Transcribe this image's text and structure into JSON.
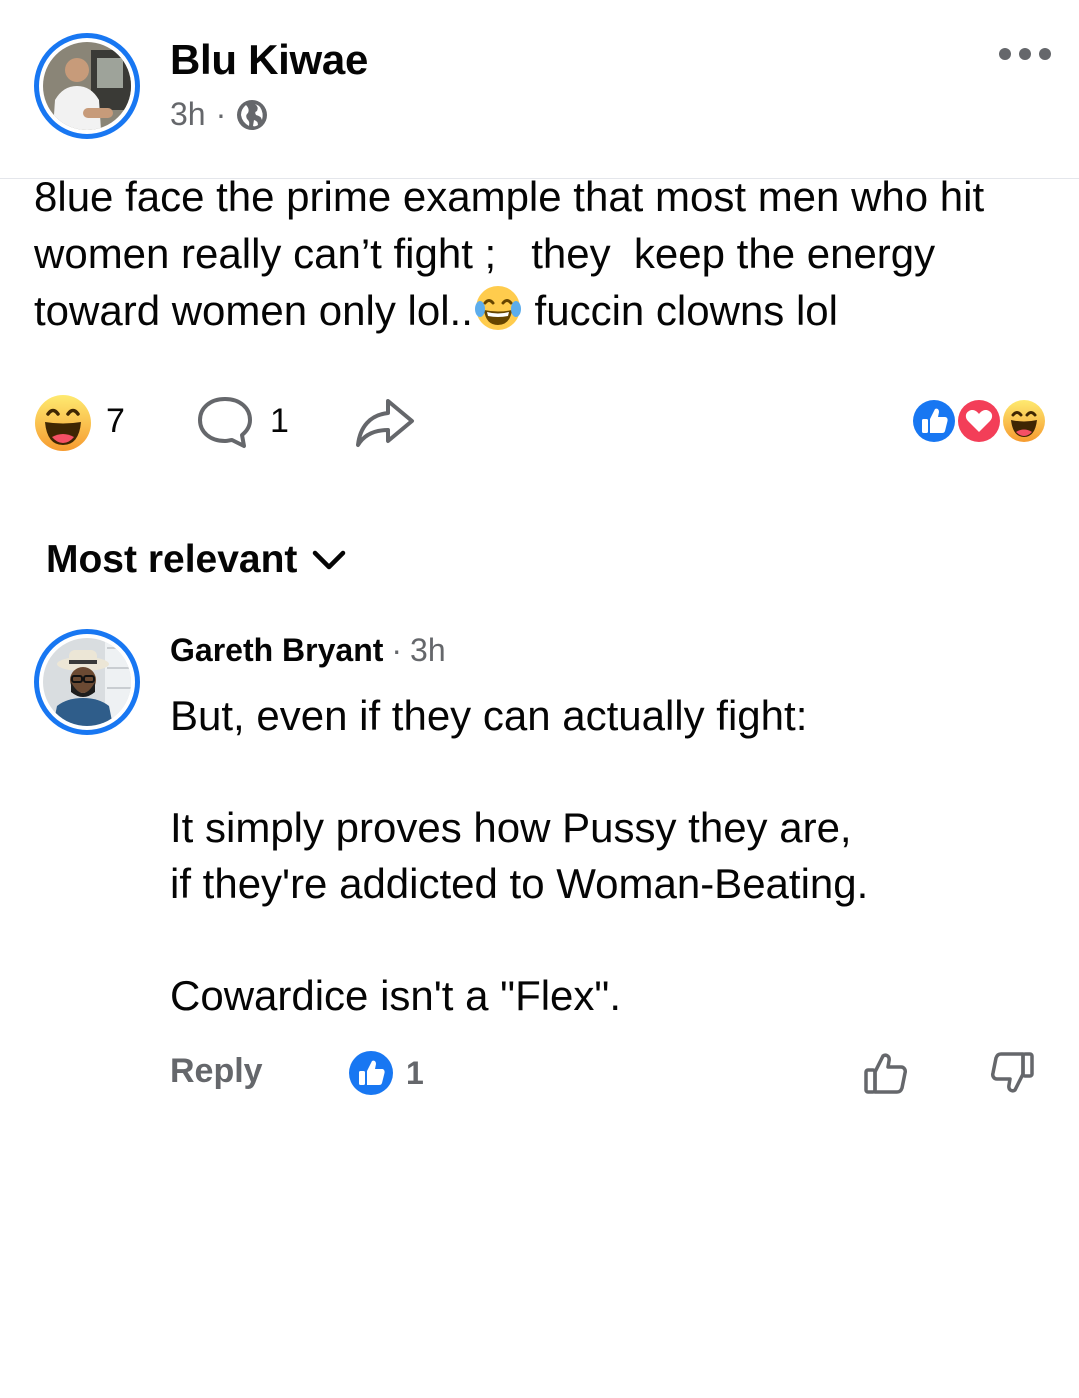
{
  "post": {
    "author": "Blu Kiwae",
    "time": "3h",
    "separator": "·",
    "privacy_icon": "globe-icon",
    "text_before_emoji": "8lue face the prime example that most men who hit women really can’t fight ;   they  keep the energy toward women only lol..",
    "inline_emoji": "tears-of-joy-emoji",
    "text_after_emoji": " fuccin clowns lol",
    "reaction_count": "7",
    "comment_count": "1",
    "reactions_summary": [
      "like-reaction-icon",
      "love-reaction-icon",
      "haha-reaction-icon"
    ]
  },
  "comments": {
    "sort_label": "Most relevant",
    "items": [
      {
        "author": "Gareth Bryant",
        "separator": "·",
        "time": "3h",
        "text": "But, even if they can actually fight:\n\nIt simply proves how Pussy they are,\nif they're addicted to Woman-Beating.\n\nCowardice isn't a \"Flex\".",
        "reply_label": "Reply",
        "like_count": "1"
      }
    ]
  },
  "colors": {
    "accent": "#1877f2",
    "secondary_text": "#65676b",
    "love": "#f33e58",
    "haha": "#f7b125"
  }
}
